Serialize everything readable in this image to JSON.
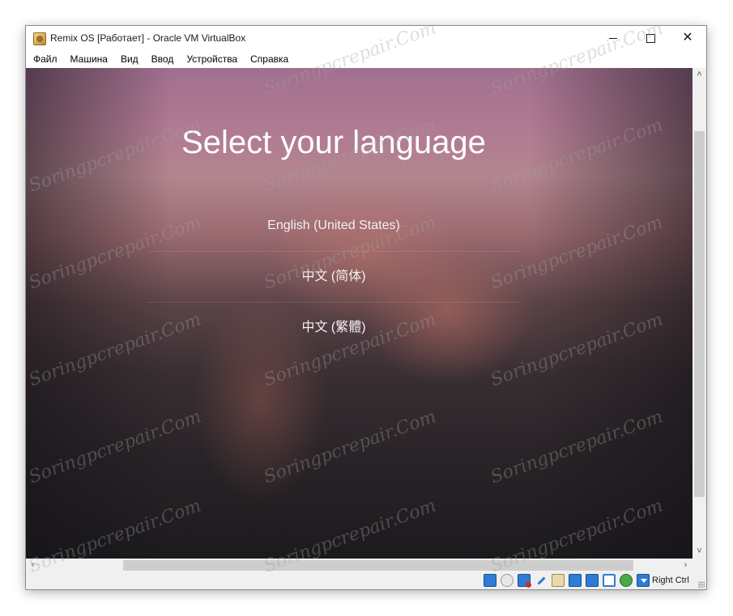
{
  "window": {
    "title": "Remix OS [Работает] - Oracle VM VirtualBox"
  },
  "menu": {
    "items": [
      "Файл",
      "Машина",
      "Вид",
      "Ввод",
      "Устройства",
      "Справка"
    ]
  },
  "guest": {
    "heading": "Select your language",
    "languages": [
      "English (United States)",
      "中文 (简体)",
      "中文 (繁體)"
    ]
  },
  "statusbar": {
    "icons": [
      "hard-disk-icon",
      "optical-drive-icon",
      "audio-icon",
      "usb-icon",
      "shared-folders-icon",
      "display-icon",
      "network-icon",
      "video-capture-icon",
      "cpu-icon",
      "mouse-integration-icon"
    ],
    "host_key": "Right Ctrl"
  },
  "watermark": {
    "text": "Soringpcrepair.Com"
  }
}
